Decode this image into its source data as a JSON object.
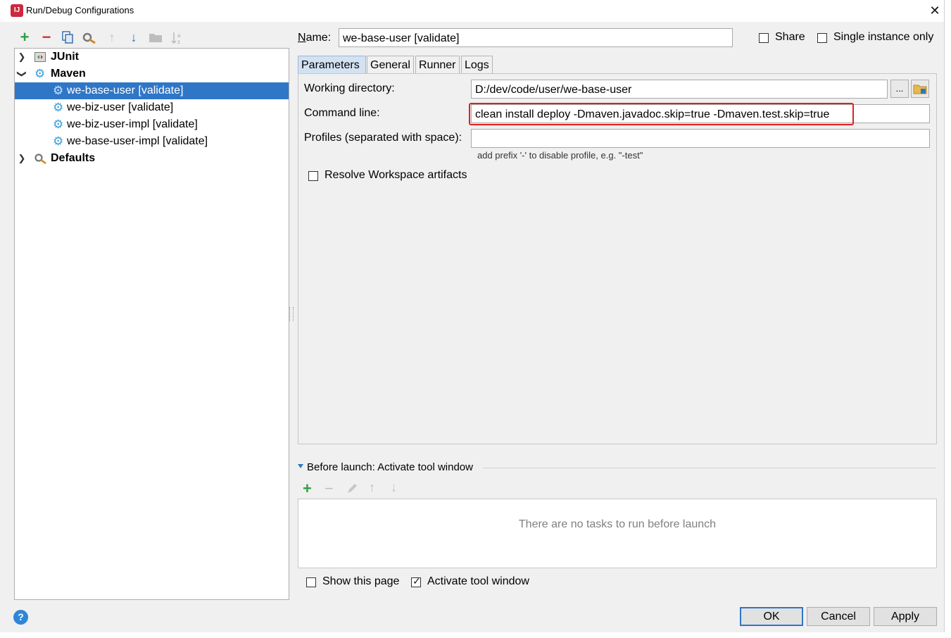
{
  "window": {
    "title": "Run/Debug Configurations",
    "close_glyph": "✕"
  },
  "toolbar": {
    "icons": [
      "add-icon",
      "remove-icon",
      "copy-icon",
      "edit-defaults-icon",
      "move-up-icon",
      "move-down-icon",
      "folder-icon",
      "sort-icon"
    ],
    "add_glyph": "+",
    "remove_glyph": "−",
    "up_glyph": "↑",
    "down_glyph": "↓"
  },
  "tree": {
    "junit": "JUnit",
    "maven": "Maven",
    "items": [
      "we-base-user [validate]",
      "we-biz-user [validate]",
      "we-biz-user-impl [validate]",
      "we-base-user-impl [validate]"
    ],
    "defaults": "Defaults",
    "selected_index": 0
  },
  "config": {
    "name_label": "Name:",
    "name_value": "we-base-user [validate]",
    "share_label": "Share",
    "share_checked": false,
    "single_instance_label": "Single instance only",
    "single_instance_checked": false
  },
  "tabs": [
    "Parameters",
    "General",
    "Runner",
    "Logs"
  ],
  "active_tab": "Parameters",
  "parameters": {
    "working_dir_label": "Working directory:",
    "working_dir_value": "D:/dev/code/user/we-base-user",
    "browse_label": "...",
    "command_line_label": "Command line:",
    "command_line_value": "clean install deploy -Dmaven.javadoc.skip=true -Dmaven.test.skip=true",
    "profiles_label": "Profiles (separated with space):",
    "profiles_value": "",
    "profiles_hint": "add prefix '-' to disable profile, e.g. \"-test\"",
    "resolve_workspace_label": "Resolve Workspace artifacts",
    "resolve_workspace_checked": false
  },
  "before_launch": {
    "title": "Before launch: Activate tool window",
    "empty_message": "There are no tasks to run before launch",
    "show_page_label": "Show this page",
    "show_page_checked": false,
    "activate_tool_label": "Activate tool window",
    "activate_tool_checked": true
  },
  "buttons": {
    "ok": "OK",
    "cancel": "Cancel",
    "apply": "Apply",
    "help": "?"
  },
  "colors": {
    "selection": "#2f76c7",
    "highlight_border": "#e02020",
    "add_green": "#2ea043",
    "remove_red": "#d9302c"
  }
}
